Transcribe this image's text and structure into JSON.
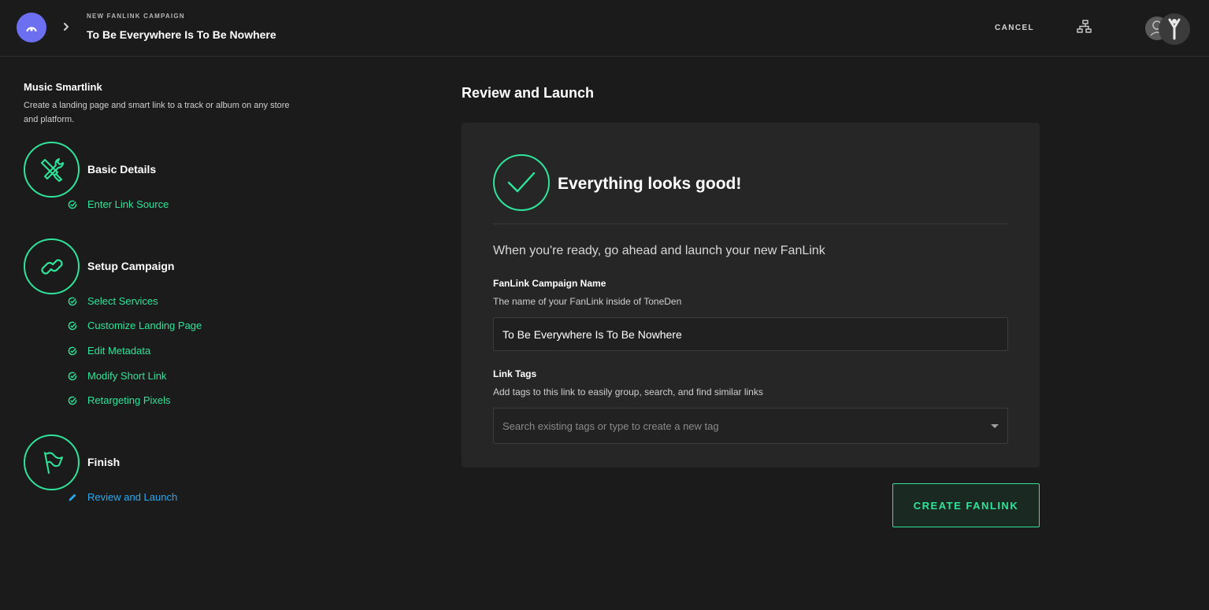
{
  "header": {
    "eyebrow": "NEW FANLINK CAMPAIGN",
    "title": "To Be Everywhere Is To Be Nowhere",
    "cancel_label": "CANCEL"
  },
  "sidebar": {
    "title": "Music Smartlink",
    "description": "Create a landing page and smart link to a track or album on any store and platform.",
    "steps": [
      {
        "title": "Basic Details",
        "icon": "tools-icon",
        "items": [
          {
            "label": "Enter Link Source",
            "status": "done"
          }
        ]
      },
      {
        "title": "Setup Campaign",
        "icon": "link-icon",
        "items": [
          {
            "label": "Select Services",
            "status": "done"
          },
          {
            "label": "Customize Landing Page",
            "status": "done"
          },
          {
            "label": "Edit Metadata",
            "status": "done"
          },
          {
            "label": "Modify Short Link",
            "status": "done"
          },
          {
            "label": "Retargeting Pixels",
            "status": "done"
          }
        ]
      },
      {
        "title": "Finish",
        "icon": "flag-icon",
        "items": [
          {
            "label": "Review and Launch",
            "status": "active"
          }
        ]
      }
    ]
  },
  "main": {
    "title": "Review and Launch",
    "success_text": "Everything looks good!",
    "ready_text": "When you're ready, go ahead and launch your new FanLink",
    "campaign_name": {
      "label": "FanLink Campaign Name",
      "help": "The name of your FanLink inside of ToneDen",
      "value": "To Be Everywhere Is To Be Nowhere"
    },
    "link_tags": {
      "label": "Link Tags",
      "help": "Add tags to this link to easily group, search, and find similar links",
      "placeholder": "Search existing tags or type to create a new tag"
    },
    "create_button": "CREATE FANLINK"
  },
  "colors": {
    "accent": "#2fe49a",
    "active": "#2ba8f0",
    "logo": "#6b6ff0",
    "background": "#1b1b1b",
    "card": "#262626"
  }
}
